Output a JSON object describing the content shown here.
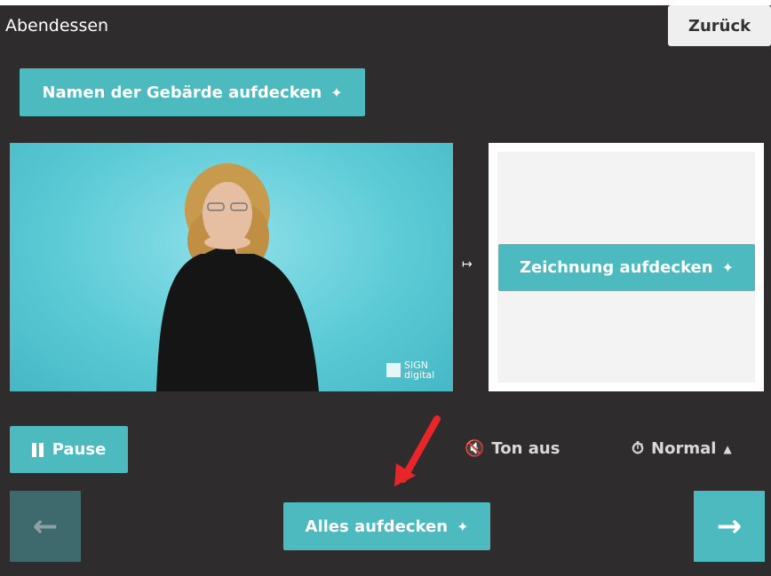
{
  "header": {
    "title": "Abendessen",
    "back_label": "Zurück"
  },
  "buttons": {
    "reveal_name": "Namen der Gebärde aufdecken",
    "reveal_drawing": "Zeichnung aufdecken",
    "pause": "Pause",
    "reveal_all": "Alles aufdecken"
  },
  "video": {
    "watermark_line1": "SIGN",
    "watermark_line2": "digital"
  },
  "controls": {
    "sound_label": "Ton aus",
    "speed_label": "Normal"
  },
  "colors": {
    "background": "#2e2c2d",
    "accent": "#4dbac0",
    "prev_disabled": "#3e6a6e",
    "annotation_arrow": "#e8262a"
  },
  "icons": {
    "sparkle": "sparkles-icon",
    "sound": "speaker-muted-icon",
    "speed": "stopwatch-icon"
  }
}
